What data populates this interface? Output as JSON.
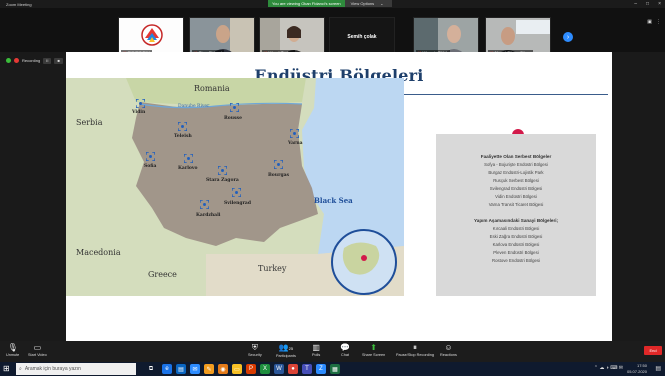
{
  "window": {
    "app_title": "Zoom Meeting",
    "recording_banner": "You are viewing Okan Fidanci's screen",
    "view_options": "View Options",
    "controls": [
      "–",
      "□",
      "×"
    ]
  },
  "participants": [
    {
      "name": "CÜNEC TAU",
      "video": "logo"
    },
    {
      "name": "Okan Fidanci",
      "video": "person"
    },
    {
      "name": "Hüsnü Taştan",
      "video": "person"
    },
    {
      "name": "Semih çolak",
      "video": "name-only"
    },
    {
      "name": "Hüseyin Tüfek",
      "video": "person"
    },
    {
      "name": "Ahmet Güven Güner",
      "video": "person"
    }
  ],
  "recording": {
    "label": "Recording",
    "pause": "II",
    "stop": "■"
  },
  "slide": {
    "title": "Endüstri Bölgeleri",
    "map": {
      "country_labels": {
        "romania": "Romania",
        "serbia": "Serbia",
        "macedonia": "Macedonia",
        "greece": "Greece",
        "turkey": "Turkey",
        "sea": "Black Sea",
        "river": "Danube River"
      },
      "cities": [
        "Vidin",
        "Rousse",
        "Teleish",
        "Varna",
        "Sofia",
        "Karlovo",
        "Stara Zagora",
        "Bourgas",
        "Svilengrad",
        "Kardzhali"
      ]
    },
    "info": {
      "section1_title": "Faaliyette Olan Serbest Bölgeler",
      "section1_items": [
        "Sofya - Bojurişte Endüstri Bölgesi",
        "Burgaz Endüstri-Lojistik Park",
        "Rusçuk Serbest Bölgesi",
        "Svilengrad Endüstri Bölgesi",
        "Vidin Endüstri Bölgesi",
        "Varna Transit Ticaret Bölgesi"
      ],
      "section2_title": "Yapım Aşamasındaki Sanayi Bölgeleri;",
      "section2_items": [
        "Kırcaali Endüstri Bölgesi",
        "Eski Zağra Endüstri Bölgesi",
        "Karlova Endüstri Bölgesi",
        "Pleven Endüstri Bölgesi",
        "Rostove Endüstri Bölgesi"
      ]
    }
  },
  "toolbar": {
    "unmute": "Unmute",
    "start_video": "Start Video",
    "security": "Security",
    "participants": "Participants",
    "participants_count": "25",
    "polls": "Polls",
    "chat": "Chat",
    "share_screen": "Share Screen",
    "pause_recording": "Pause/Stop Recording",
    "reactions": "Reactions",
    "end": "End"
  },
  "taskbar": {
    "search_placeholder": "Aramak için buraya yazın",
    "time": "17:50",
    "date": "05.07.2020"
  },
  "colors": {
    "title": "#1e3f6b",
    "bulgaria": "#9c8f86",
    "sea": "#bcd7f2",
    "land": "#d4ddbd",
    "marker": "#1f5fbf",
    "pin": "#d21a4a",
    "end_button": "#e02828",
    "zoom_blue": "#2d8cff"
  }
}
